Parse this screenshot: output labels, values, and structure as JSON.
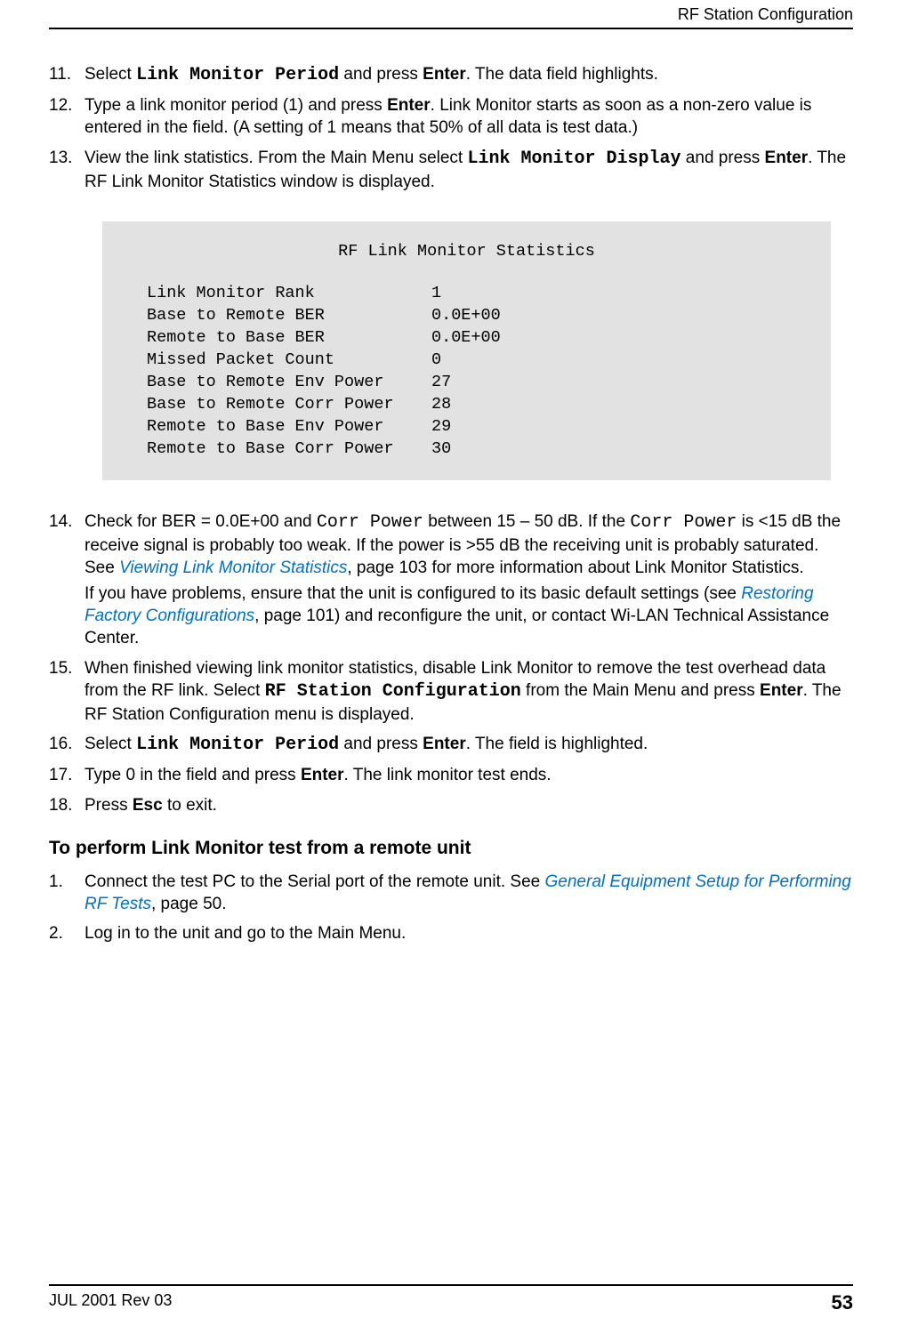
{
  "header": {
    "title": "RF Station Configuration"
  },
  "steps_a": [
    {
      "num": "11.",
      "parts": [
        {
          "t": "plain",
          "v": "Select "
        },
        {
          "t": "mono",
          "v": "Link Monitor Period"
        },
        {
          "t": "plain",
          "v": " and press "
        },
        {
          "t": "key",
          "v": "Enter"
        },
        {
          "t": "plain",
          "v": ". The data field highlights."
        }
      ]
    },
    {
      "num": "12.",
      "parts": [
        {
          "t": "plain",
          "v": "Type a link monitor period (1) and press "
        },
        {
          "t": "key",
          "v": "Enter"
        },
        {
          "t": "plain",
          "v": ". Link Monitor starts as soon as a non-zero value is entered in the field. (A setting of 1 means that 50% of all data is test data.)"
        }
      ]
    },
    {
      "num": "13.",
      "parts": [
        {
          "t": "plain",
          "v": "View the link statistics. From the Main Menu select "
        },
        {
          "t": "mono",
          "v": "Link Monitor Display"
        },
        {
          "t": "plain",
          "v": " and press "
        },
        {
          "t": "key",
          "v": "Enter"
        },
        {
          "t": "plain",
          "v": ". The RF Link Monitor Statistics window is displayed."
        }
      ]
    }
  ],
  "box": {
    "title": "RF Link Monitor Statistics",
    "rows": [
      {
        "label": "Link Monitor Rank",
        "value": "1"
      },
      {
        "label": "Base to Remote BER",
        "value": "0.0E+00"
      },
      {
        "label": "Remote to Base BER",
        "value": "0.0E+00"
      },
      {
        "label": "Missed Packet Count",
        "value": "0"
      },
      {
        "label": "Base to Remote Env Power",
        "value": "27"
      },
      {
        "label": "Base to Remote Corr Power",
        "value": "28"
      },
      {
        "label": "Remote to Base Env Power",
        "value": "29"
      },
      {
        "label": "Remote to Base Corr Power",
        "value": "30"
      }
    ]
  },
  "steps_b": [
    {
      "num": "14.",
      "parts": [
        {
          "t": "plain",
          "v": "Check for BER = 0.0E+00 and "
        },
        {
          "t": "monoplain",
          "v": "Corr Power"
        },
        {
          "t": "plain",
          "v": " between 15 – 50 dB. If the "
        },
        {
          "t": "monoplain",
          "v": "Corr Power"
        },
        {
          "t": "plain",
          "v": " is <15 dB the receive signal is probably too weak. If the power is >55 dB the receiving unit is probably saturated. See "
        },
        {
          "t": "link",
          "v": "Viewing Link Monitor Statistics"
        },
        {
          "t": "plain",
          "v": ", page 103 for more information about Link Monitor Statistics."
        }
      ],
      "extra": [
        {
          "t": "plain",
          "v": "If you have problems, ensure that the unit is configured to its basic default settings (see "
        },
        {
          "t": "link",
          "v": "Restoring Factory Configurations"
        },
        {
          "t": "plain",
          "v": ", page 101) and reconfigure the unit, or contact Wi-LAN Technical Assistance Center."
        }
      ]
    },
    {
      "num": "15.",
      "parts": [
        {
          "t": "plain",
          "v": "When finished viewing link monitor statistics, disable Link Monitor to remove the test overhead data from the RF link. Select "
        },
        {
          "t": "mono",
          "v": "RF Station Configuration"
        },
        {
          "t": "plain",
          "v": " from the Main Menu and press "
        },
        {
          "t": "key",
          "v": "Enter"
        },
        {
          "t": "plain",
          "v": ". The RF Station Configuration menu is displayed."
        }
      ]
    },
    {
      "num": "16.",
      "parts": [
        {
          "t": "plain",
          "v": "Select "
        },
        {
          "t": "mono",
          "v": "Link Monitor Period"
        },
        {
          "t": "plain",
          "v": " and press "
        },
        {
          "t": "key",
          "v": "Enter"
        },
        {
          "t": "plain",
          "v": ". The field is highlighted."
        }
      ]
    },
    {
      "num": "17.",
      "parts": [
        {
          "t": "plain",
          "v": "Type 0 in the field and press "
        },
        {
          "t": "key",
          "v": "Enter"
        },
        {
          "t": "plain",
          "v": ". The link monitor test ends."
        }
      ]
    },
    {
      "num": "18.",
      "parts": [
        {
          "t": "plain",
          "v": "Press "
        },
        {
          "t": "key",
          "v": "Esc"
        },
        {
          "t": "plain",
          "v": " to exit."
        }
      ]
    }
  ],
  "subhead": "To perform Link Monitor test from a remote unit",
  "steps_c": [
    {
      "num": "1.",
      "parts": [
        {
          "t": "plain",
          "v": "Connect the test PC to the Serial port of the remote unit. See "
        },
        {
          "t": "link",
          "v": "General Equipment Setup for Performing RF Tests"
        },
        {
          "t": "plain",
          "v": ", page 50."
        }
      ]
    },
    {
      "num": "2.",
      "parts": [
        {
          "t": "plain",
          "v": "Log in to the unit and go to the Main Menu."
        }
      ]
    }
  ],
  "footer": {
    "left": "JUL 2001 Rev 03",
    "right": "53"
  }
}
